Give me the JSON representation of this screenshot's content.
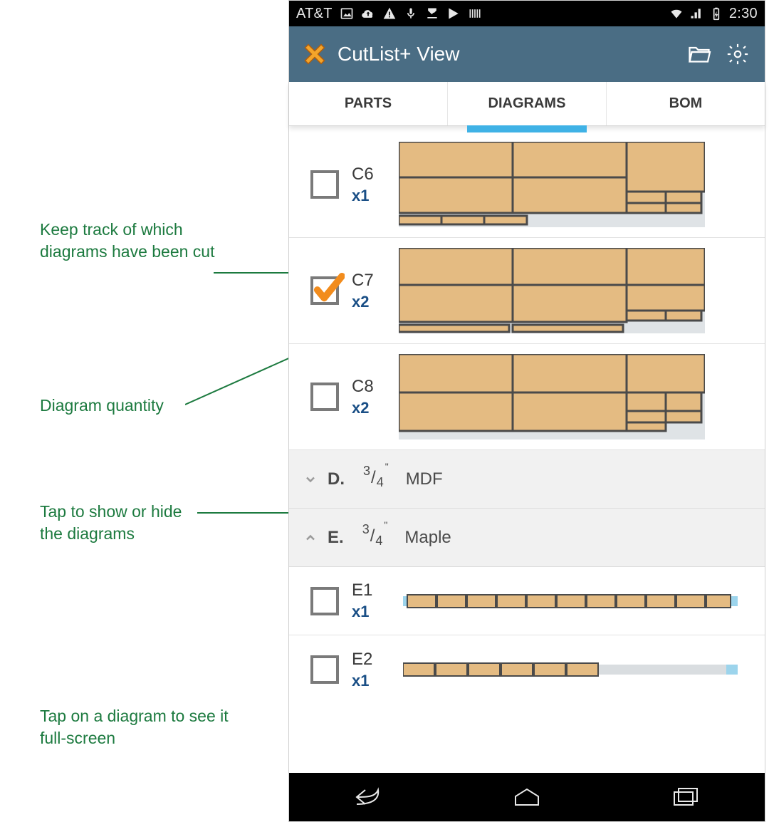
{
  "statusbar": {
    "carrier": "AT&T",
    "time": "2:30"
  },
  "appbar": {
    "title": "CutList+ View"
  },
  "tabs": {
    "parts": "PARTS",
    "diagrams": "DIAGRAMS",
    "bom": "BOM",
    "active": "diagrams"
  },
  "diagrams": {
    "items": [
      {
        "id": "C6",
        "qty": "x1",
        "checked": false,
        "shape": "sheet"
      },
      {
        "id": "C7",
        "qty": "x2",
        "checked": true,
        "shape": "sheet"
      },
      {
        "id": "C8",
        "qty": "x2",
        "checked": false,
        "shape": "sheet"
      }
    ]
  },
  "groups": [
    {
      "letter": "D.",
      "thickness_num": "3",
      "thickness_den": "4",
      "thickness_unit": "\"",
      "material": "MDF",
      "expanded": false
    },
    {
      "letter": "E.",
      "thickness_num": "3",
      "thickness_den": "4",
      "thickness_unit": "\"",
      "material": "Maple",
      "expanded": true
    }
  ],
  "group_e_items": [
    {
      "id": "E1",
      "qty": "x1",
      "checked": false,
      "shape": "strip"
    },
    {
      "id": "E2",
      "qty": "x1",
      "checked": false,
      "shape": "strip_partial"
    }
  ],
  "annotations": {
    "a1": "Keep track of which diagrams have been cut",
    "a2": "Diagram quantity",
    "a3": "Tap to show or hide the diagrams",
    "a4": "Tap on a diagram to see it full-screen"
  },
  "colors": {
    "anno": "#1c7a3f",
    "appbar": "#4a6d84",
    "tab_underline": "#3fb2e6",
    "wood": "#e4bb82",
    "wood_stroke": "#4a4a4a",
    "qty": "#1a4f86",
    "check": "#f28c1d"
  }
}
